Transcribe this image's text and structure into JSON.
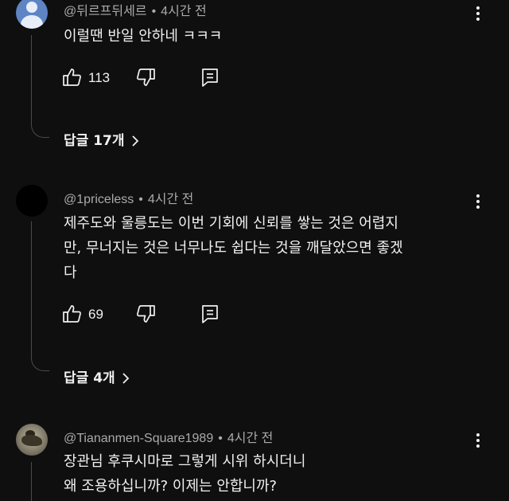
{
  "comments": [
    {
      "author": "@뒤르프뒤세르",
      "separator": "•",
      "time": "4시간 전",
      "text": [
        "이럴땐 반일 안하네 ㅋㅋㅋ"
      ],
      "likes": "113",
      "replies_label": "답글 17개"
    },
    {
      "author": "@1priceless",
      "separator": "•",
      "time": "4시간 전",
      "text": [
        "제주도와 울릉도는 이번 기회에 신뢰를 쌓는 것은 어렵지",
        "만, 무너지는 것은 너무나도 쉽다는 것을 깨달았으면 좋겠",
        "다"
      ],
      "likes": "69",
      "replies_label": "답글 4개"
    },
    {
      "author": "@Tiananmen-Square1989",
      "separator": "•",
      "time": "4시간 전",
      "text": [
        "장관님 후쿠시마로 그렇게 시위 하시더니",
        "왜 조용하십니까? 이제는 안합니까?"
      ]
    }
  ],
  "icons": {
    "like": "thumbs-up-icon",
    "dislike": "thumbs-down-icon",
    "reply": "reply-icon",
    "more": "more-vertical-icon",
    "expand": "chevron-right-icon"
  },
  "colors": {
    "background": "#0f0f0f",
    "text": "#f1f1f1",
    "meta": "#aaaaaa",
    "thread_line": "#4a4a4a"
  }
}
